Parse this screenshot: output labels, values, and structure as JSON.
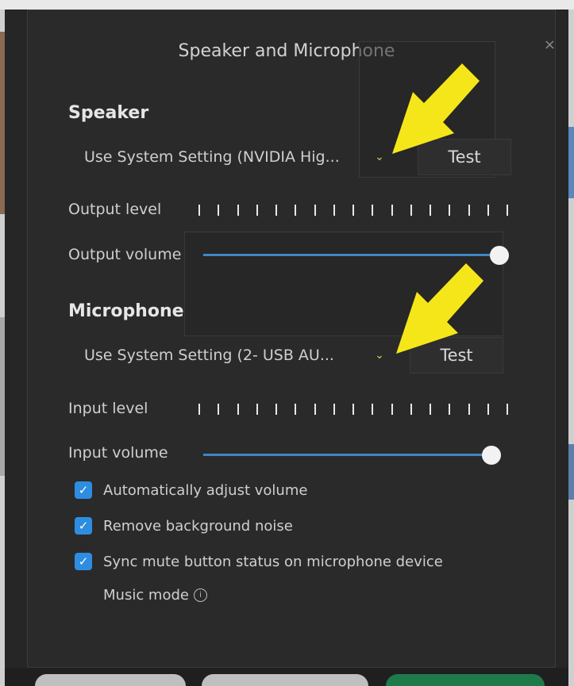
{
  "dialog": {
    "title": "Speaker and Microphone",
    "close_glyph": "×"
  },
  "speaker": {
    "heading": "Speaker",
    "device": "Use System Setting (NVIDIA Hig...",
    "test_label": "Test",
    "output_level_label": "Output level",
    "output_volume_label": "Output volume",
    "output_volume_value": 1.0
  },
  "microphone": {
    "heading": "Microphone",
    "device": "Use System Setting (2- USB AU...",
    "test_label": "Test",
    "input_level_label": "Input level",
    "input_volume_label": "Input volume",
    "input_volume_value": 1.0
  },
  "options": [
    {
      "label": "Automatically adjust volume",
      "checked": true
    },
    {
      "label": "Remove background noise",
      "checked": true
    },
    {
      "label": "Sync mute button status on microphone device",
      "checked": true
    }
  ],
  "music_mode": {
    "label": "Music mode",
    "info_icon": "info-icon"
  },
  "colors": {
    "accent": "#2e8de0",
    "slider_track": "#3d87c6",
    "annotation_arrow": "#f5e61a",
    "chevron": "#e2c84a",
    "dialog_bg": "#262626"
  }
}
